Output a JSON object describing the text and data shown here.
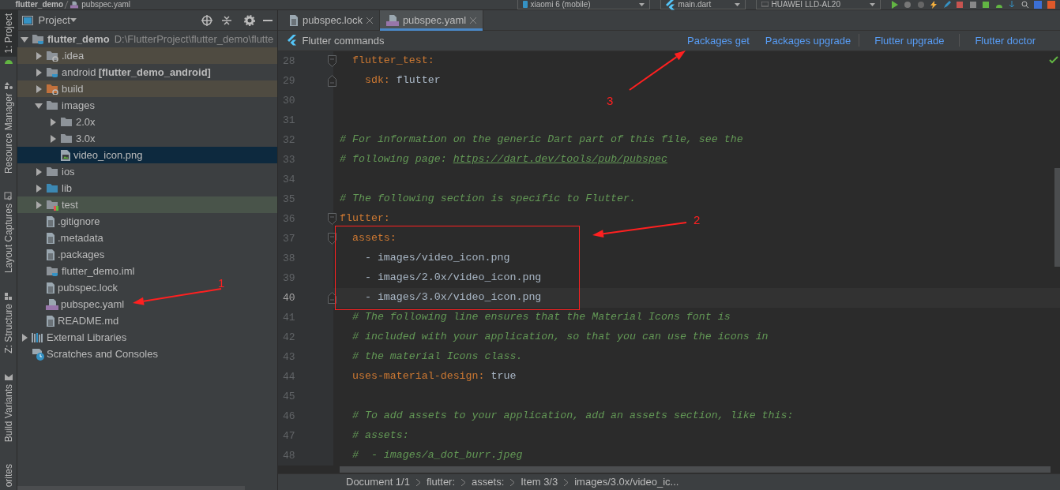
{
  "top_bar": {
    "breadcrumb": [
      "flutter_demo",
      "pubspec.yaml"
    ],
    "device": "xiaomi 6 (mobile)",
    "run_config": "main.dart",
    "emulator": "HUAWEI LLD-AL20"
  },
  "side_tabs": [
    {
      "label": "1: Project",
      "selected": true
    },
    {
      "label": "Resource Manager",
      "selected": false
    },
    {
      "label": "Layout Captures",
      "selected": false
    },
    {
      "label": "Z: Structure",
      "selected": false
    },
    {
      "label": "Build Variants",
      "selected": false
    },
    {
      "label": "orites",
      "selected": false
    }
  ],
  "project_panel": {
    "title": "Project",
    "tree": [
      {
        "label": "flutter_demo",
        "bold": true,
        "path": "D:\\FlutterProject\\flutter_demo\\flutte",
        "kind": "module",
        "expanded": true,
        "selected": false,
        "children": [
          {
            "label": ".idea",
            "kind": "config",
            "color": "#4f4b41",
            "expanded": false,
            "selected": false
          },
          {
            "label": "android",
            "module": "[flutter_demo_android]",
            "kind": "module",
            "expanded": false,
            "selected": false
          },
          {
            "label": "build",
            "kind": "excluded",
            "color": "#4f4b41",
            "expanded": false,
            "selected": false
          },
          {
            "label": "images",
            "kind": "folder",
            "expanded": true,
            "selected": false,
            "children": [
              {
                "label": "2.0x",
                "kind": "folder",
                "expanded": false,
                "selected": false
              },
              {
                "label": "3.0x",
                "kind": "folder",
                "expanded": false,
                "selected": false
              },
              {
                "label": "video_icon.png",
                "kind": "image",
                "selected": true
              }
            ]
          },
          {
            "label": "ios",
            "kind": "folder",
            "expanded": false,
            "selected": false
          },
          {
            "label": "lib",
            "kind": "source",
            "expanded": false,
            "selected": false
          },
          {
            "label": "test",
            "kind": "test",
            "color": "#49544a",
            "expanded": false,
            "selected": false
          },
          {
            "label": ".gitignore",
            "kind": "text",
            "selected": false
          },
          {
            "label": ".metadata",
            "kind": "text",
            "selected": false
          },
          {
            "label": ".packages",
            "kind": "text",
            "selected": false
          },
          {
            "label": "flutter_demo.iml",
            "kind": "module",
            "selected": false
          },
          {
            "label": "pubspec.lock",
            "kind": "text",
            "selected": false
          },
          {
            "label": "pubspec.yaml",
            "kind": "yaml",
            "selected": false
          },
          {
            "label": "README.md",
            "kind": "text",
            "selected": false
          }
        ]
      },
      {
        "label": "External Libraries",
        "kind": "library",
        "expanded": false,
        "selected": false
      },
      {
        "label": "Scratches and Consoles",
        "kind": "scratches",
        "selected": false
      }
    ]
  },
  "editor_tabs": [
    {
      "label": "pubspec.lock",
      "kind": "text",
      "selected": false
    },
    {
      "label": "pubspec.yaml",
      "kind": "yaml",
      "selected": true
    }
  ],
  "flutter_bar": {
    "title": "Flutter commands",
    "actions": [
      "Packages get",
      "Packages upgrade",
      "Flutter upgrade",
      "Flutter doctor"
    ]
  },
  "code_lines": [
    {
      "number": "28",
      "kind": "fold-start",
      "selected": false,
      "parts": [
        {
          "kind": "key",
          "text": "  flutter_test"
        },
        {
          "kind": "plain",
          "text": ":"
        }
      ]
    },
    {
      "number": "29",
      "kind": "fold-end",
      "selected": false,
      "parts": [
        {
          "kind": "key",
          "text": "    sdk"
        },
        {
          "kind": "plain",
          "text": ": "
        },
        {
          "kind": "value",
          "text": "flutter"
        }
      ]
    },
    {
      "number": "30",
      "kind": "plain",
      "selected": false
    },
    {
      "number": "31",
      "kind": "plain",
      "selected": false
    },
    {
      "number": "32",
      "kind": "plain",
      "selected": false,
      "parts": [
        {
          "kind": "comment",
          "text": "# For information on the generic Dart part of this file, see the"
        }
      ]
    },
    {
      "number": "33",
      "kind": "plain",
      "selected": false,
      "parts": [
        {
          "kind": "comment",
          "text": "# following page: "
        },
        {
          "kind": "link",
          "text": "https://dart.dev/tools/pub/pubspec"
        }
      ]
    },
    {
      "number": "34",
      "kind": "plain",
      "selected": false
    },
    {
      "number": "35",
      "kind": "plain",
      "selected": false,
      "parts": [
        {
          "kind": "comment",
          "text": "# The following section is specific to Flutter."
        }
      ]
    },
    {
      "number": "36",
      "kind": "fold-start",
      "selected": false,
      "parts": [
        {
          "kind": "key",
          "text": "flutter"
        },
        {
          "kind": "plain",
          "text": ":"
        }
      ]
    },
    {
      "number": "37",
      "kind": "fold-start",
      "selected": false,
      "parts": [
        {
          "kind": "key",
          "text": "  assets"
        },
        {
          "kind": "plain",
          "text": ":"
        }
      ]
    },
    {
      "number": "38",
      "kind": "plain",
      "selected": false,
      "parts": [
        {
          "kind": "value",
          "text": "    - images/video_icon.png"
        }
      ]
    },
    {
      "number": "39",
      "kind": "plain",
      "selected": false,
      "parts": [
        {
          "kind": "value",
          "text": "    - images/2.0x/video_icon.png"
        }
      ]
    },
    {
      "number": "40",
      "kind": "fold-end",
      "selected": true,
      "parts": [
        {
          "kind": "value",
          "text": "    - images/3.0x/video_icon.png"
        }
      ]
    },
    {
      "number": "41",
      "kind": "plain",
      "selected": false,
      "parts": [
        {
          "kind": "comment",
          "text": "  # The following line ensures that the Material Icons font is"
        }
      ]
    },
    {
      "number": "42",
      "kind": "plain",
      "selected": false,
      "parts": [
        {
          "kind": "comment",
          "text": "  # included with your application, so that you can use the icons in"
        }
      ]
    },
    {
      "number": "43",
      "kind": "plain",
      "selected": false,
      "parts": [
        {
          "kind": "comment",
          "text": "  # the material Icons class."
        }
      ]
    },
    {
      "number": "44",
      "kind": "plain",
      "selected": false,
      "parts": [
        {
          "kind": "key",
          "text": "  uses-material-design"
        },
        {
          "kind": "plain",
          "text": ": "
        },
        {
          "kind": "value",
          "text": "true"
        }
      ]
    },
    {
      "number": "45",
      "kind": "plain",
      "selected": false
    },
    {
      "number": "46",
      "kind": "plain",
      "selected": false,
      "parts": [
        {
          "kind": "comment",
          "text": "  # To add assets to your application, add an assets section, like this:"
        }
      ]
    },
    {
      "number": "47",
      "kind": "plain",
      "selected": false,
      "parts": [
        {
          "kind": "comment",
          "text": "  # assets:"
        }
      ]
    },
    {
      "number": "48",
      "kind": "plain",
      "selected": false,
      "parts": [
        {
          "kind": "comment",
          "text": "  #  - images/a_dot_burr.jpeg"
        }
      ]
    }
  ],
  "status_bar": {
    "breadcrumbs": [
      "Document 1/1",
      "flutter:",
      "assets:",
      "Item 3/3",
      "images/3.0x/video_ic..."
    ]
  },
  "annotations": [
    {
      "kind": "box"
    },
    {
      "kind": "arrow",
      "label": "1"
    },
    {
      "kind": "arrow",
      "label": "2"
    },
    {
      "kind": "arrow",
      "label": "3"
    }
  ]
}
